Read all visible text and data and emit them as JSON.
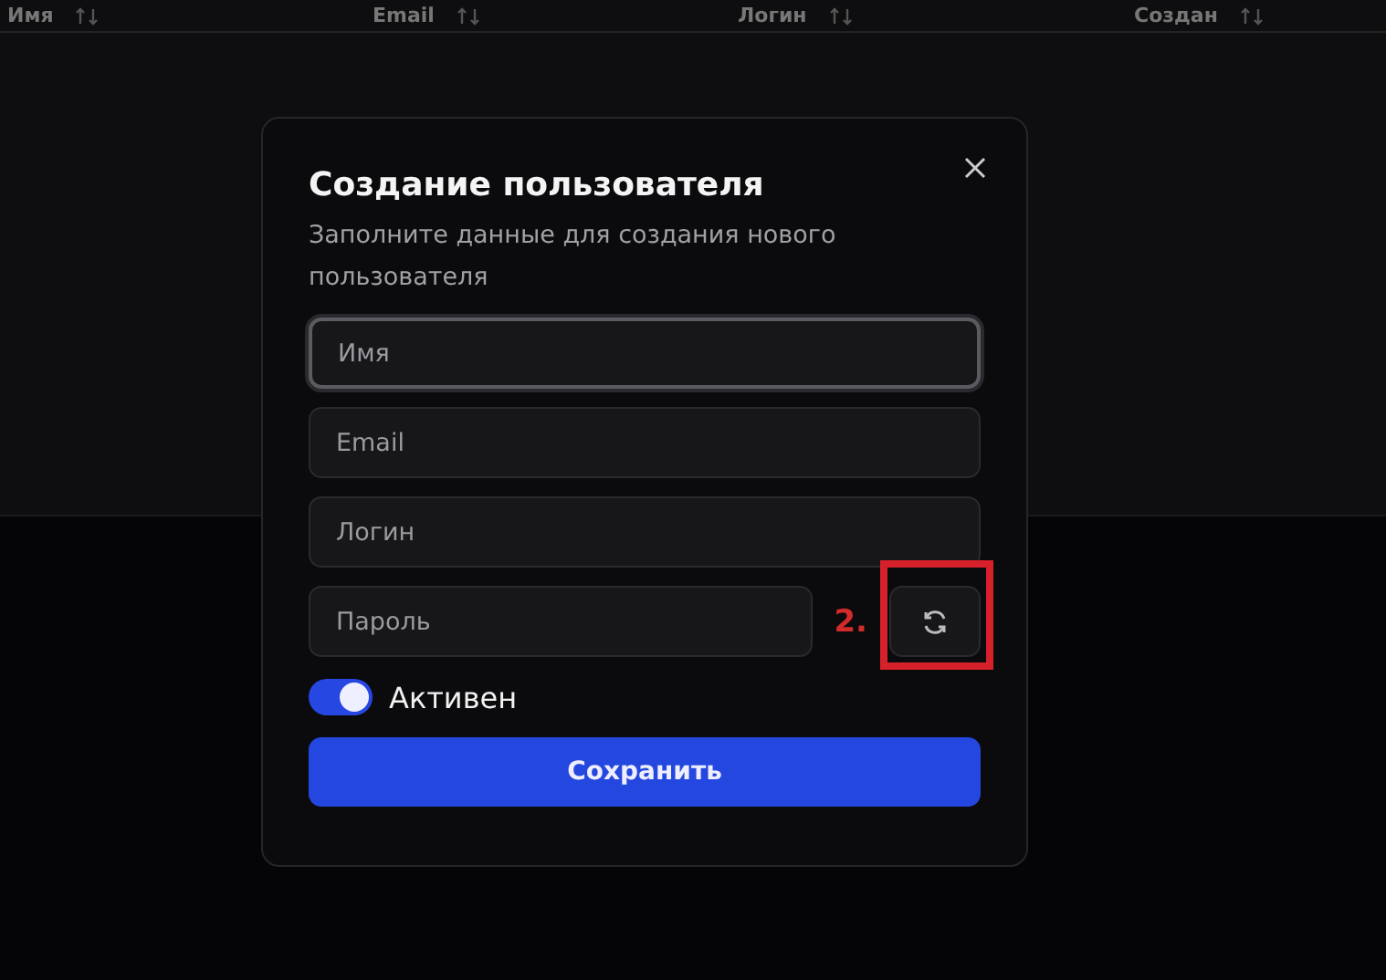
{
  "table": {
    "columns": [
      {
        "label": "Имя"
      },
      {
        "label": "Email"
      },
      {
        "label": "Логин"
      },
      {
        "label": "Создан"
      }
    ]
  },
  "dialog": {
    "title": "Создание пользователя",
    "description": "Заполните данные для создания нового пользователя",
    "fields": [
      {
        "kind": "text",
        "placeholder": "Имя",
        "focused": true
      },
      {
        "kind": "text",
        "placeholder": "Email",
        "focused": false
      },
      {
        "kind": "text",
        "placeholder": "Логин",
        "focused": false
      },
      {
        "kind": "password",
        "placeholder": "Пароль",
        "focused": false
      }
    ],
    "toggle": {
      "label": "Активен",
      "on": true
    },
    "submit": "Сохранить"
  },
  "annotation": {
    "label": "2."
  }
}
